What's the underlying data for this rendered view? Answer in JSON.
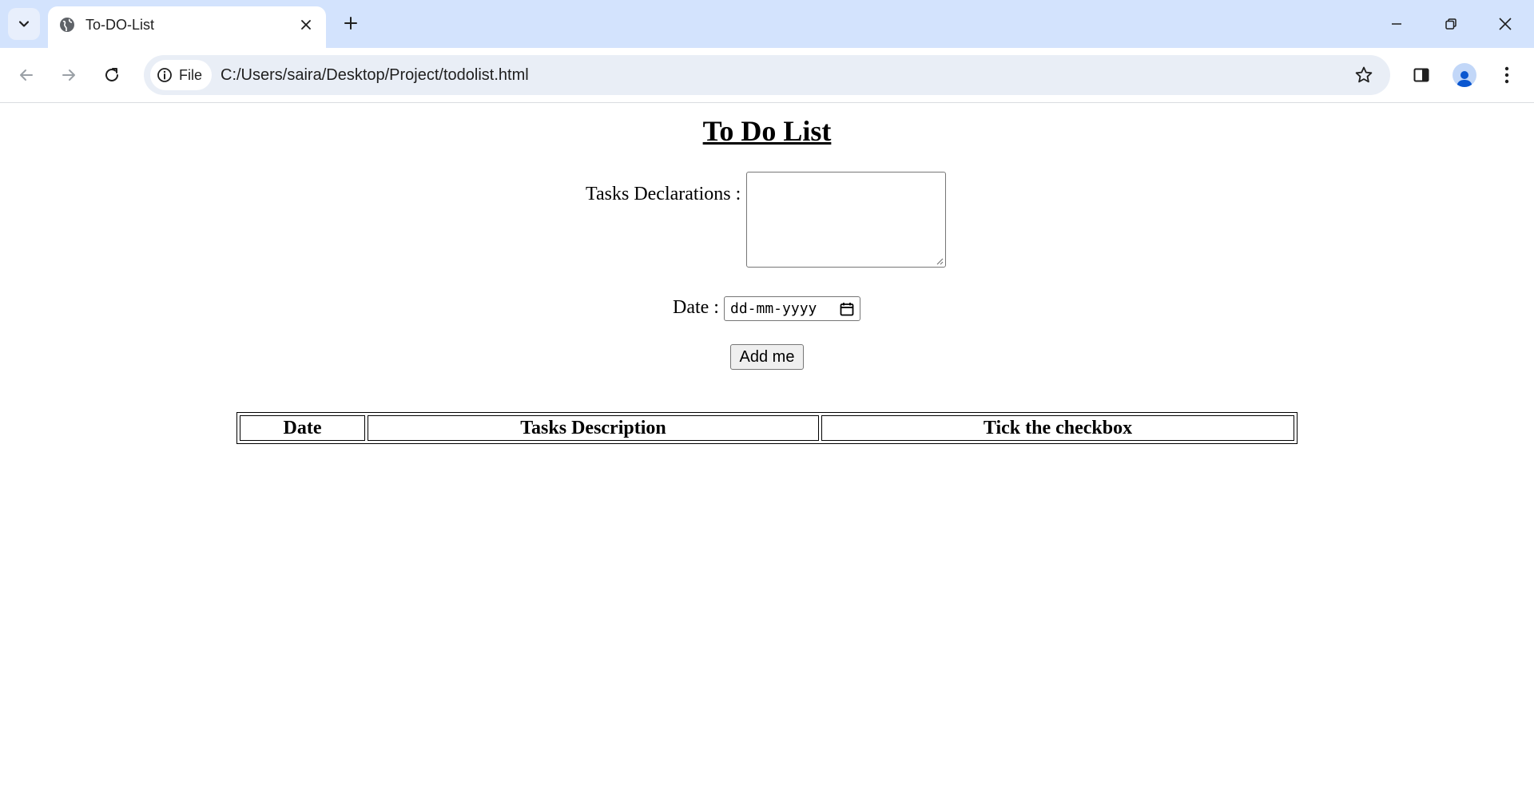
{
  "browser": {
    "tab": {
      "title": "To-DO-List"
    },
    "omnibox": {
      "chip_label": "File",
      "url": "C:/Users/saira/Desktop/Project/todolist.html"
    }
  },
  "page": {
    "title": "To Do List",
    "form": {
      "task_label": "Tasks Declarations :",
      "date_label": "Date :",
      "date_placeholder": "dd-mm-yyyy",
      "submit_label": "Add me"
    },
    "table": {
      "columns": [
        "Date",
        "Tasks Description",
        "Tick the checkbox"
      ]
    }
  },
  "colors": {
    "tabstrip": "#d3e3fd",
    "omnibox": "#e9eef6"
  }
}
